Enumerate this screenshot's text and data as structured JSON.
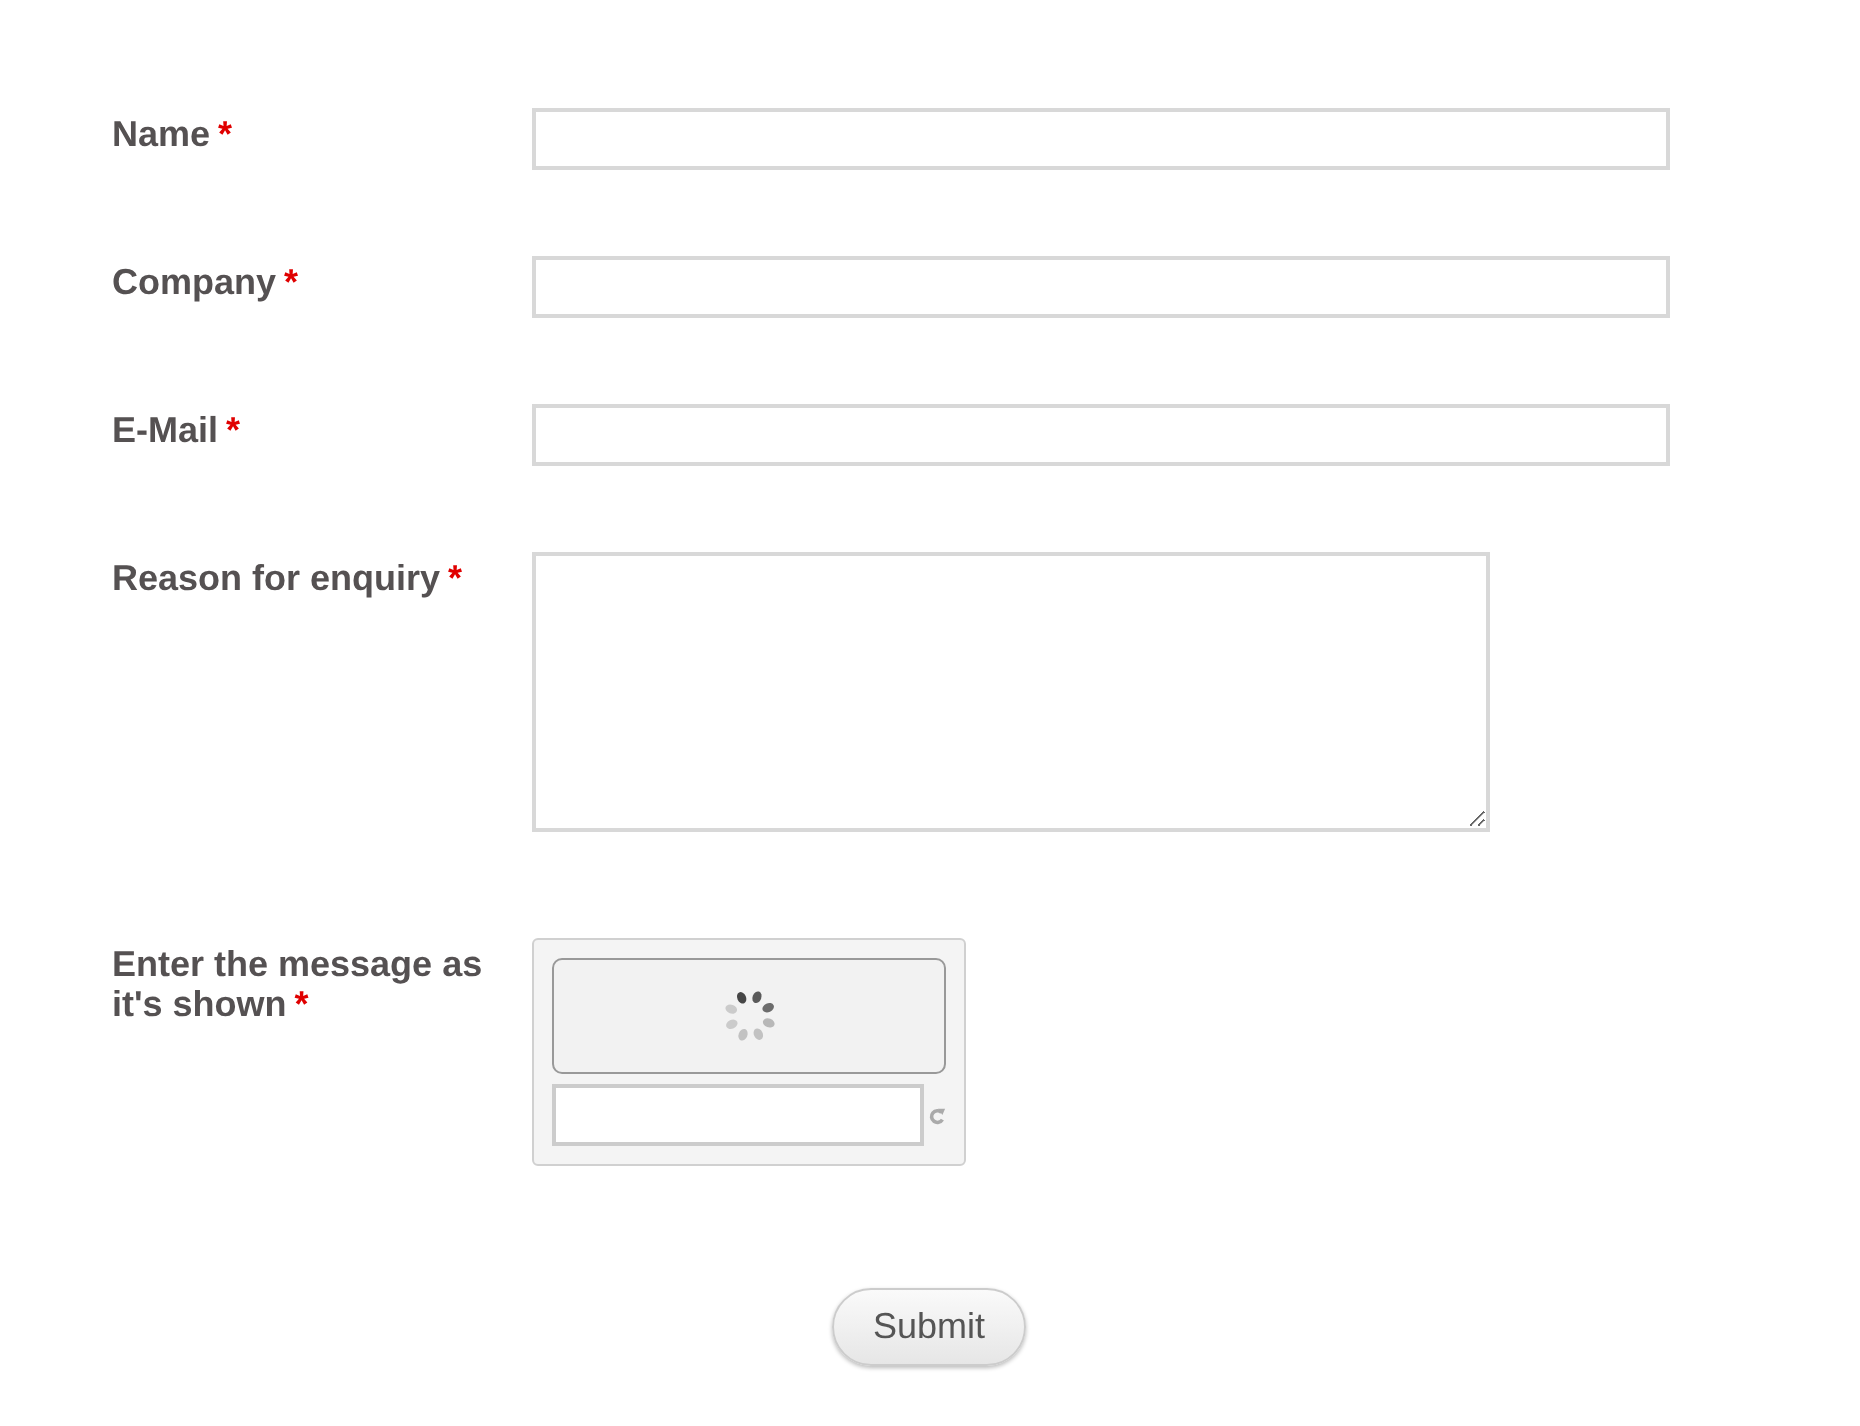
{
  "fields": [
    {
      "kind": "text",
      "label": "Name",
      "required_mark": "*"
    },
    {
      "kind": "text",
      "label": "Company",
      "required_mark": "*"
    },
    {
      "kind": "text",
      "label": "E-Mail",
      "required_mark": "*"
    },
    {
      "kind": "textarea",
      "label": "Reason for enquiry",
      "required_mark": "*"
    },
    {
      "kind": "captcha",
      "label": "Enter the message as it's shown",
      "required_mark": "*"
    }
  ],
  "submit": "Submit"
}
